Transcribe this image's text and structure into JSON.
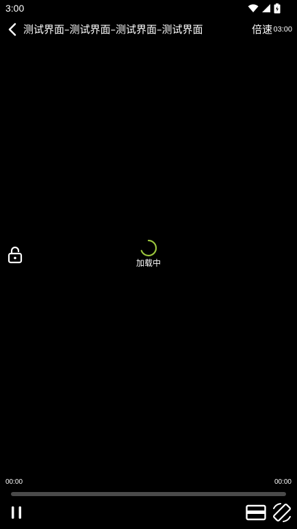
{
  "status_bar": {
    "time": "3:00",
    "icons": [
      "wifi-icon",
      "cellular-signal-icon",
      "battery-icon"
    ]
  },
  "header": {
    "back_icon": "chevron-left-icon",
    "title": "测试界面–测试界面–测试界面–测试界面",
    "speed_label": "倍速",
    "duration": "03:00"
  },
  "side_controls": {
    "lock_icon": "unlocked-padlock-icon"
  },
  "loading": {
    "text": "加载中",
    "spinner_color": "#9bc53d"
  },
  "playback": {
    "current_time": "00:00",
    "total_time": "00:00",
    "progress_fraction": 0,
    "track_color": "#4a4a4a"
  },
  "bottom_controls": {
    "pause_icon": "pause-icon",
    "pip_icon": "picture-in-picture-icon",
    "rotate_icon": "screen-rotation-icon"
  },
  "colors": {
    "background": "#000000",
    "foreground": "#ffffff",
    "accent": "#9bc53d"
  }
}
